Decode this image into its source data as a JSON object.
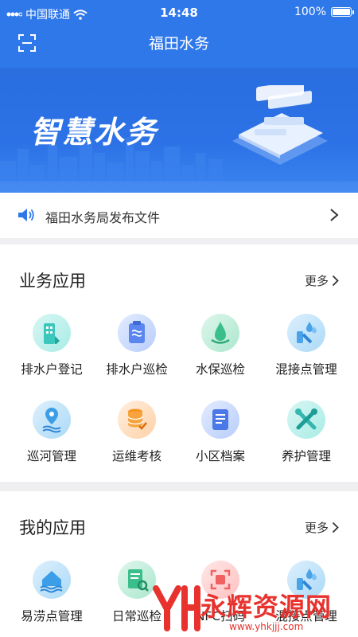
{
  "status_bar": {
    "carrier": "中国联通",
    "time": "14:48",
    "battery": "100%"
  },
  "nav": {
    "title": "福田水务"
  },
  "banner": {
    "title": "智慧水务"
  },
  "notice": {
    "text": "福田水务局发布文件"
  },
  "business_apps": {
    "title": "业务应用",
    "more": "更多",
    "items": [
      {
        "label": "排水户登记",
        "icon": "building-icon",
        "color": "#3cc7bd"
      },
      {
        "label": "排水户巡检",
        "icon": "clipboard-icon",
        "color": "#5b86f0"
      },
      {
        "label": "水保巡检",
        "icon": "water-drop-icon",
        "color": "#3bbf8a"
      },
      {
        "label": "混接点管理",
        "icon": "pipe-drops-icon",
        "color": "#4aa3e8"
      },
      {
        "label": "巡河管理",
        "icon": "river-pin-icon",
        "color": "#3b9ee6"
      },
      {
        "label": "运维考核",
        "icon": "database-check-icon",
        "color": "#f7931e"
      },
      {
        "label": "小区档案",
        "icon": "archive-icon",
        "color": "#4a78e8"
      },
      {
        "label": "养护管理",
        "icon": "tools-icon",
        "color": "#36b6b0"
      }
    ]
  },
  "my_apps": {
    "title": "我的应用",
    "more": "更多",
    "items": [
      {
        "label": "易涝点管理",
        "icon": "flood-house-icon",
        "color": "#3b9ee6"
      },
      {
        "label": "日常巡检",
        "icon": "document-search-icon",
        "color": "#3bbf8a"
      },
      {
        "label": "NFC扫码",
        "icon": "nfc-scan-icon",
        "color": "#f06262"
      },
      {
        "label": "混接点管理",
        "icon": "pipe-drops-icon",
        "color": "#4aa3e8"
      }
    ]
  },
  "watermark": {
    "text": "永辉资源网",
    "url": "www.yhkjjj.com"
  }
}
